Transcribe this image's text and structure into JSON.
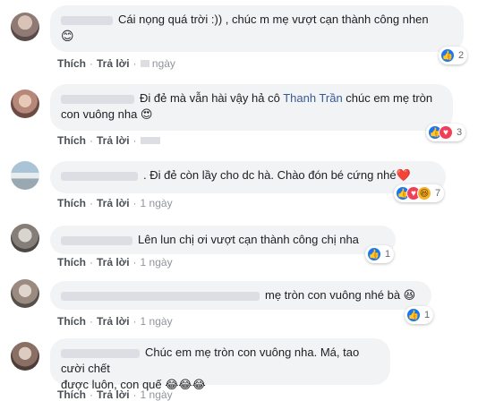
{
  "comments": [
    {
      "line1": "Cái nọng quá trời :)) , chúc m mẹ vượt cạn thành công nhen",
      "line2": "😊",
      "reaction_count": "2",
      "like": "Thích",
      "reply": "Trả lời",
      "time": "ngày"
    },
    {
      "line1_pre": "Đi đẻ mà vẫn hài vậy hả cô ",
      "mention": "Thanh Trần",
      "line1_post": " chúc em mẹ tròn",
      "line2": "con vuông nha 😍",
      "reaction_count": "3",
      "like": "Thích",
      "reply": "Trả lời",
      "time": ""
    },
    {
      "line1": ". Đi đẻ còn lầy cho dc hà. Chào đón bé cứng nhé❤️",
      "reaction_count": "7",
      "like": "Thích",
      "reply": "Trả lời",
      "time": "1 ngày"
    },
    {
      "line1": "Lên lun chị ơi vượt cạn thành công chị nha",
      "reaction_count": "1",
      "like": "Thích",
      "reply": "Trả lời",
      "time": "1 ngày"
    },
    {
      "line1": "mẹ tròn con vuông nhé bà 😆",
      "reaction_count": "1",
      "like": "Thích",
      "reply": "Trả lời",
      "time": "1 ngày"
    },
    {
      "line1": "Chúc em mẹ tròn con vuông nha. Má, tao cười chết",
      "line2": "được luôn, con quế 😂😂😂",
      "reaction_count": "",
      "like": "Thích",
      "reply": "Trả lời",
      "time": "1 ngày"
    }
  ],
  "icons": {
    "like": "thumbs-up-icon",
    "love": "heart-icon",
    "haha": "laugh-icon"
  },
  "colors": {
    "bubble": "#f2f3f5",
    "mention": "#385898",
    "like_blue": "#1877f2",
    "love_red": "#f33e58",
    "haha_yellow": "#f7b125"
  }
}
